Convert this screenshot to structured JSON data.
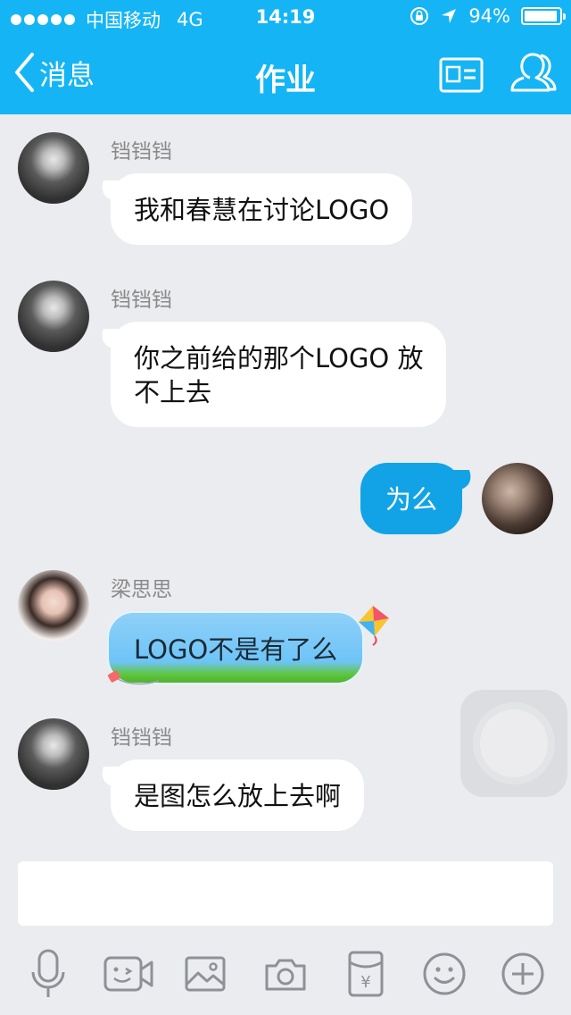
{
  "status": {
    "carrier": "中国移动",
    "network": "4G",
    "time": "14:19",
    "battery": "94%",
    "battery_level": 0.94
  },
  "nav": {
    "back_label": "消息",
    "title": "作业"
  },
  "messages": [
    {
      "sender": "铛铛铛",
      "text": "我和春慧在讨论LOGO"
    },
    {
      "sender": "铛铛铛",
      "text_line1": "你之前给的那个LOGO 放",
      "text_line2": "不上去"
    },
    {
      "sender": "",
      "text": "为么"
    },
    {
      "sender": "梁思思",
      "text": "LOGO不是有了么"
    },
    {
      "sender": "铛铛铛",
      "text": "是图怎么放上去啊"
    }
  ],
  "input": {
    "placeholder": "",
    "value": ""
  },
  "toolbar": [
    "microphone-icon",
    "video-icon",
    "image-icon",
    "camera-icon",
    "red-packet-icon",
    "emoji-icon",
    "plus-icon"
  ],
  "colors": {
    "accent": "#15b5f5",
    "outgoing_bubble": "#12a3e6",
    "background": "#ebecf0"
  }
}
